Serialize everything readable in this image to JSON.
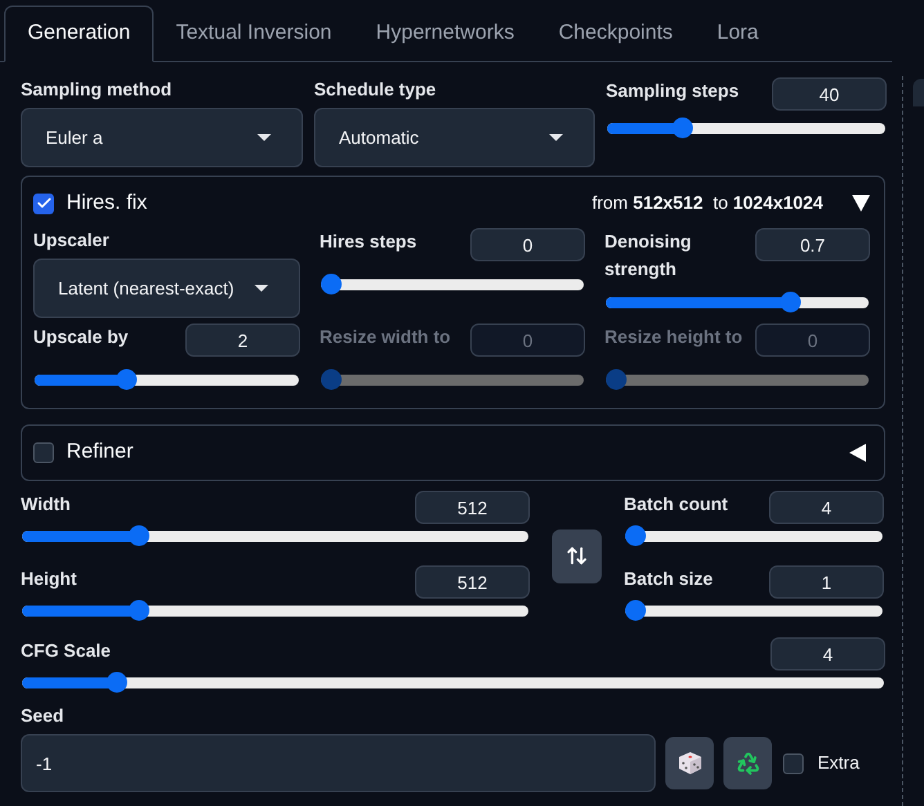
{
  "tabs": [
    {
      "label": "Generation",
      "selected": true
    },
    {
      "label": "Textual Inversion",
      "selected": false
    },
    {
      "label": "Hypernetworks",
      "selected": false
    },
    {
      "label": "Checkpoints",
      "selected": false
    },
    {
      "label": "Lora",
      "selected": false
    }
  ],
  "sampling_method": {
    "label": "Sampling method",
    "value": "Euler a"
  },
  "schedule_type": {
    "label": "Schedule type",
    "value": "Automatic"
  },
  "sampling_steps": {
    "label": "Sampling steps",
    "value": "40",
    "level": 0.27
  },
  "hires_fix": {
    "label": "Hires. fix",
    "checked": true,
    "expanded": true,
    "summary": "from **512x512**  to **1024x1024**",
    "upscaler": {
      "label": "Upscaler",
      "value": "Latent (nearest-exact)"
    },
    "sliders": [
      {
        "label": "Hires steps",
        "value": "0",
        "level": 0,
        "disabled": false
      },
      {
        "label": "Denoising strength",
        "value": "0.7",
        "level": 0.7,
        "disabled": false
      },
      {
        "label": "Upscale by",
        "value": "2",
        "level": 0.35,
        "disabled": false
      },
      {
        "label": "Resize width to",
        "value": "0",
        "level": 0,
        "disabled": true
      },
      {
        "label": "Resize height to",
        "value": "0",
        "level": 0,
        "disabled": true
      }
    ]
  },
  "refiner": {
    "label": "Refiner",
    "checked": false,
    "expanded": false
  },
  "size_sliders": [
    {
      "label": "Width",
      "value": "512",
      "level": 0.23
    },
    {
      "label": "Height",
      "value": "512",
      "level": 0.23
    }
  ],
  "batch_sliders": [
    {
      "label": "Batch count",
      "value": "4",
      "level": 0.04
    },
    {
      "label": "Batch size",
      "value": "1",
      "level": 0
    }
  ],
  "cfg_scale": {
    "label": "CFG Scale",
    "value": "4",
    "level": 0.11
  },
  "seed": {
    "label": "Seed",
    "value": "-1"
  },
  "extra": {
    "label": "Extra",
    "checked": false
  }
}
